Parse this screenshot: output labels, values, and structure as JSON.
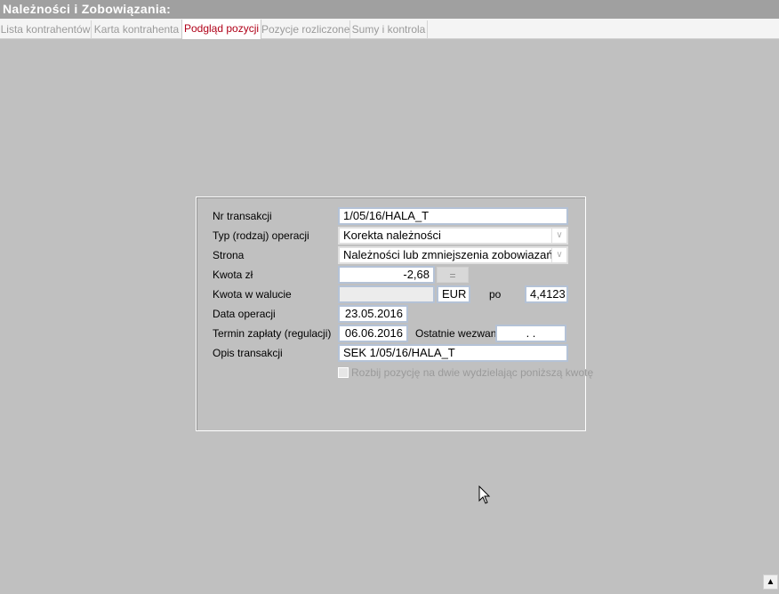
{
  "window": {
    "title": "Należności i Zobowiązania:"
  },
  "tabs": [
    {
      "label": "Lista kontrahentów",
      "active": false
    },
    {
      "label": "Karta kontrahenta",
      "active": false
    },
    {
      "label": "Podgląd pozycji",
      "active": true
    },
    {
      "label": "Pozycje rozliczone",
      "active": false
    },
    {
      "label": "Sumy i kontrola",
      "active": false
    }
  ],
  "form": {
    "nr_transakcji_label": "Nr transakcji",
    "nr_transakcji_value": "1/05/16/HALA_T",
    "typ_label": "Typ (rodzaj) operacji",
    "typ_value": "Korekta należności",
    "strona_label": "Strona",
    "strona_value": "Należności lub zmniejszenia zobowiazań",
    "kwota_zl_label": "Kwota zł",
    "kwota_zl_value": "-2,68",
    "eq_button": "=",
    "kwota_waluta_label": "Kwota w walucie",
    "kwota_waluta_value": "",
    "currency_value": "EUR",
    "po_label": "po",
    "rate_value": "4,4123",
    "data_operacji_label": "Data operacji",
    "data_operacji_value": "23.05.2016",
    "termin_label": "Termin zapłaty (regulacji)",
    "termin_value": "06.06.2016",
    "ostatnie_label": "Ostatnie wezwanie",
    "ostatnie_value": ". .",
    "opis_label": "Opis transakcji",
    "opis_value": "SEK 1/05/16/HALA_T",
    "split_checkbox_label": "Rozbij pozycję na dwie wydzielając poniższą kwotę",
    "split_checked": false
  },
  "icons": {
    "combo_arrow": "chevron-down-icon",
    "cursor": "mouse-pointer-icon",
    "scroll_up": "caret-up-icon"
  }
}
